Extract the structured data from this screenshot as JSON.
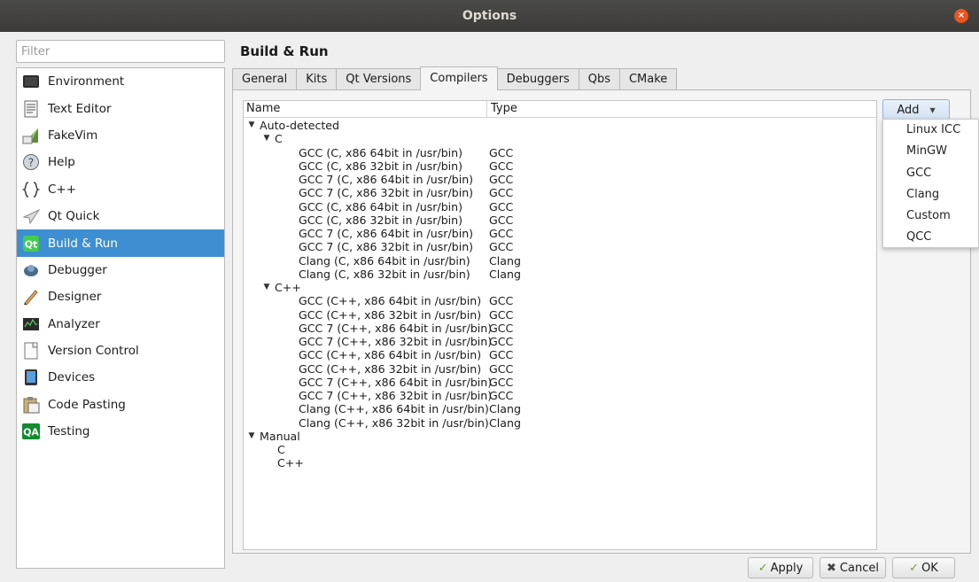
{
  "window": {
    "title": "Options",
    "close_symbol": "×"
  },
  "filter": {
    "placeholder": "Filter",
    "value": ""
  },
  "sidebar": {
    "items": [
      {
        "label": "Environment",
        "icon": "environment-icon"
      },
      {
        "label": "Text Editor",
        "icon": "text-editor-icon"
      },
      {
        "label": "FakeVim",
        "icon": "fakevim-icon"
      },
      {
        "label": "Help",
        "icon": "help-icon"
      },
      {
        "label": "C++",
        "icon": "cpp-icon"
      },
      {
        "label": "Qt Quick",
        "icon": "qt-quick-icon"
      },
      {
        "label": "Build & Run",
        "icon": "build-run-icon",
        "selected": true
      },
      {
        "label": "Debugger",
        "icon": "debugger-icon"
      },
      {
        "label": "Designer",
        "icon": "designer-icon"
      },
      {
        "label": "Analyzer",
        "icon": "analyzer-icon"
      },
      {
        "label": "Version Control",
        "icon": "version-control-icon"
      },
      {
        "label": "Devices",
        "icon": "devices-icon"
      },
      {
        "label": "Code Pasting",
        "icon": "code-pasting-icon"
      },
      {
        "label": "Testing",
        "icon": "testing-icon"
      }
    ]
  },
  "page": {
    "title": "Build & Run"
  },
  "tabs": [
    {
      "label": "General"
    },
    {
      "label": "Kits"
    },
    {
      "label": "Qt Versions"
    },
    {
      "label": "Compilers",
      "active": true
    },
    {
      "label": "Debuggers"
    },
    {
      "label": "Qbs"
    },
    {
      "label": "CMake"
    }
  ],
  "tree": {
    "columns": {
      "name": "Name",
      "type": "Type"
    },
    "rows": [
      {
        "level": 0,
        "expanded": true,
        "name": "Auto-detected",
        "type": ""
      },
      {
        "level": 1,
        "expanded": true,
        "name": "C",
        "type": ""
      },
      {
        "level": 2,
        "name": "GCC (C, x86 64bit in /usr/bin)",
        "type": "GCC"
      },
      {
        "level": 2,
        "name": "GCC (C, x86 32bit in /usr/bin)",
        "type": "GCC"
      },
      {
        "level": 2,
        "name": "GCC 7 (C, x86 64bit in /usr/bin)",
        "type": "GCC"
      },
      {
        "level": 2,
        "name": "GCC 7 (C, x86 32bit in /usr/bin)",
        "type": "GCC"
      },
      {
        "level": 2,
        "name": "GCC (C, x86 64bit in /usr/bin)",
        "type": "GCC"
      },
      {
        "level": 2,
        "name": "GCC (C, x86 32bit in /usr/bin)",
        "type": "GCC"
      },
      {
        "level": 2,
        "name": "GCC 7 (C, x86 64bit in /usr/bin)",
        "type": "GCC"
      },
      {
        "level": 2,
        "name": "GCC 7 (C, x86 32bit in /usr/bin)",
        "type": "GCC"
      },
      {
        "level": 2,
        "name": "Clang (C, x86 64bit in /usr/bin)",
        "type": "Clang"
      },
      {
        "level": 2,
        "name": "Clang (C, x86 32bit in /usr/bin)",
        "type": "Clang"
      },
      {
        "level": 1,
        "expanded": true,
        "name": "C++",
        "type": ""
      },
      {
        "level": 2,
        "name": "GCC (C++, x86 64bit in /usr/bin)",
        "type": "GCC"
      },
      {
        "level": 2,
        "name": "GCC (C++, x86 32bit in /usr/bin)",
        "type": "GCC"
      },
      {
        "level": 2,
        "name": "GCC 7 (C++, x86 64bit in /usr/bin)",
        "type": "GCC"
      },
      {
        "level": 2,
        "name": "GCC 7 (C++, x86 32bit in /usr/bin)",
        "type": "GCC"
      },
      {
        "level": 2,
        "name": "GCC (C++, x86 64bit in /usr/bin)",
        "type": "GCC"
      },
      {
        "level": 2,
        "name": "GCC (C++, x86 32bit in /usr/bin)",
        "type": "GCC"
      },
      {
        "level": 2,
        "name": "GCC 7 (C++, x86 64bit in /usr/bin)",
        "type": "GCC"
      },
      {
        "level": 2,
        "name": "GCC 7 (C++, x86 32bit in /usr/bin)",
        "type": "GCC"
      },
      {
        "level": 2,
        "name": "Clang (C++, x86 64bit in /usr/bin)",
        "type": "Clang"
      },
      {
        "level": 2,
        "name": "Clang (C++, x86 32bit in /usr/bin)",
        "type": "Clang"
      },
      {
        "level": 0,
        "expanded": true,
        "name": "Manual",
        "type": ""
      },
      {
        "level": 1,
        "name": "C",
        "type": ""
      },
      {
        "level": 1,
        "name": "C++",
        "type": ""
      }
    ]
  },
  "add_button": {
    "label": "Add",
    "menu": [
      "Linux ICC",
      "MinGW",
      "GCC",
      "Clang",
      "Custom",
      "QCC"
    ]
  },
  "buttons": {
    "apply": "Apply",
    "cancel": "Cancel",
    "ok": "OK"
  },
  "colors": {
    "selection": "#3d8fd1",
    "titlebar": "#3c3b37",
    "close": "#e95420"
  }
}
